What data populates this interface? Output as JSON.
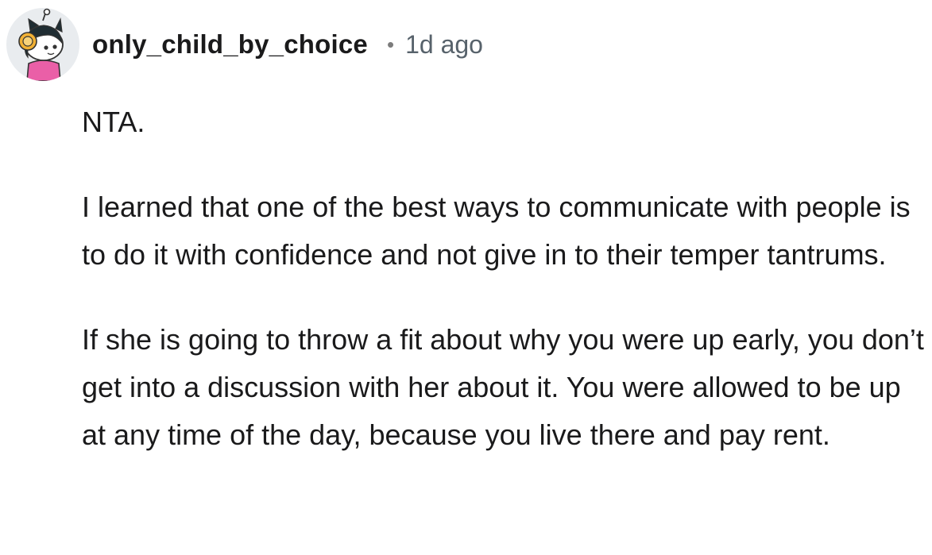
{
  "comment": {
    "author": "only_child_by_choice",
    "separator": "•",
    "timestamp": "1d ago",
    "avatar_icon": "snoo-avatar-icon",
    "paragraphs": [
      "NTA.",
      "I learned that one of the best ways to communicate with people is to do it with confidence and not give in to their temper tantrums.",
      "If she is going to throw a fit about why you were up early, you don’t get into a discussion with her about it. You were allowed to be up at any time of the day, because you live there and pay rent."
    ]
  },
  "colors": {
    "text": "#1a1a1b",
    "meta": "#57626b",
    "avatar_bg": "#e9ecef",
    "avatar_shirt": "#ea5fa7",
    "avatar_accent": "#f2b134"
  }
}
